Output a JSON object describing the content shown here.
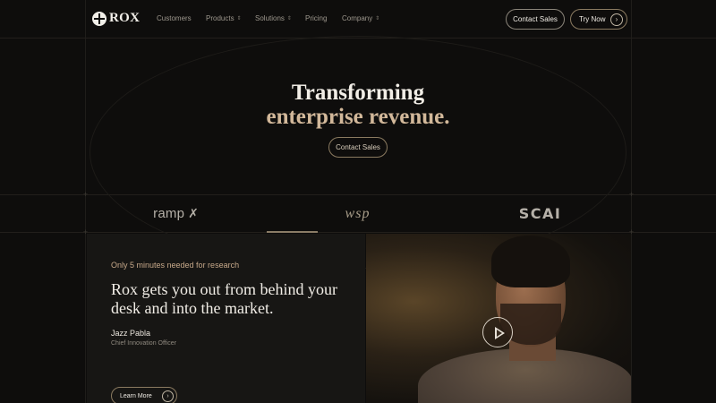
{
  "brand": {
    "name": "ROX"
  },
  "nav": {
    "links": [
      {
        "label": "Customers"
      },
      {
        "label": "Products",
        "has_dropdown": true
      },
      {
        "label": "Solutions",
        "has_dropdown": true
      },
      {
        "label": "Pricing"
      },
      {
        "label": "Company",
        "has_dropdown": true
      }
    ],
    "contact_label": "Contact Sales",
    "try_label": "Try Now"
  },
  "hero": {
    "line1": "Transforming",
    "line2": "enterprise revenue.",
    "cta_label": "Contact Sales"
  },
  "logo_strip": {
    "items": [
      {
        "name": "ramp"
      },
      {
        "name": "wsp"
      },
      {
        "name": "SCAI"
      }
    ],
    "active_index": 1
  },
  "testimonial": {
    "eyebrow": "Only 5 minutes needed for research",
    "quote": "Rox gets you out from behind your desk and into the market.",
    "name": "Jazz Pabla",
    "role": "Chief Innovation Officer",
    "cta_label": "Learn More"
  },
  "colors": {
    "background": "#0e0d0c",
    "accent_gold": "#d2b89a",
    "text_primary": "#f1ede6",
    "text_muted": "#9d978d"
  },
  "icons": {
    "logo": "rox-logo-icon",
    "dropdown": "chevron-down-icon",
    "arrow": "arrow-right-circle-icon",
    "play": "play-icon"
  }
}
